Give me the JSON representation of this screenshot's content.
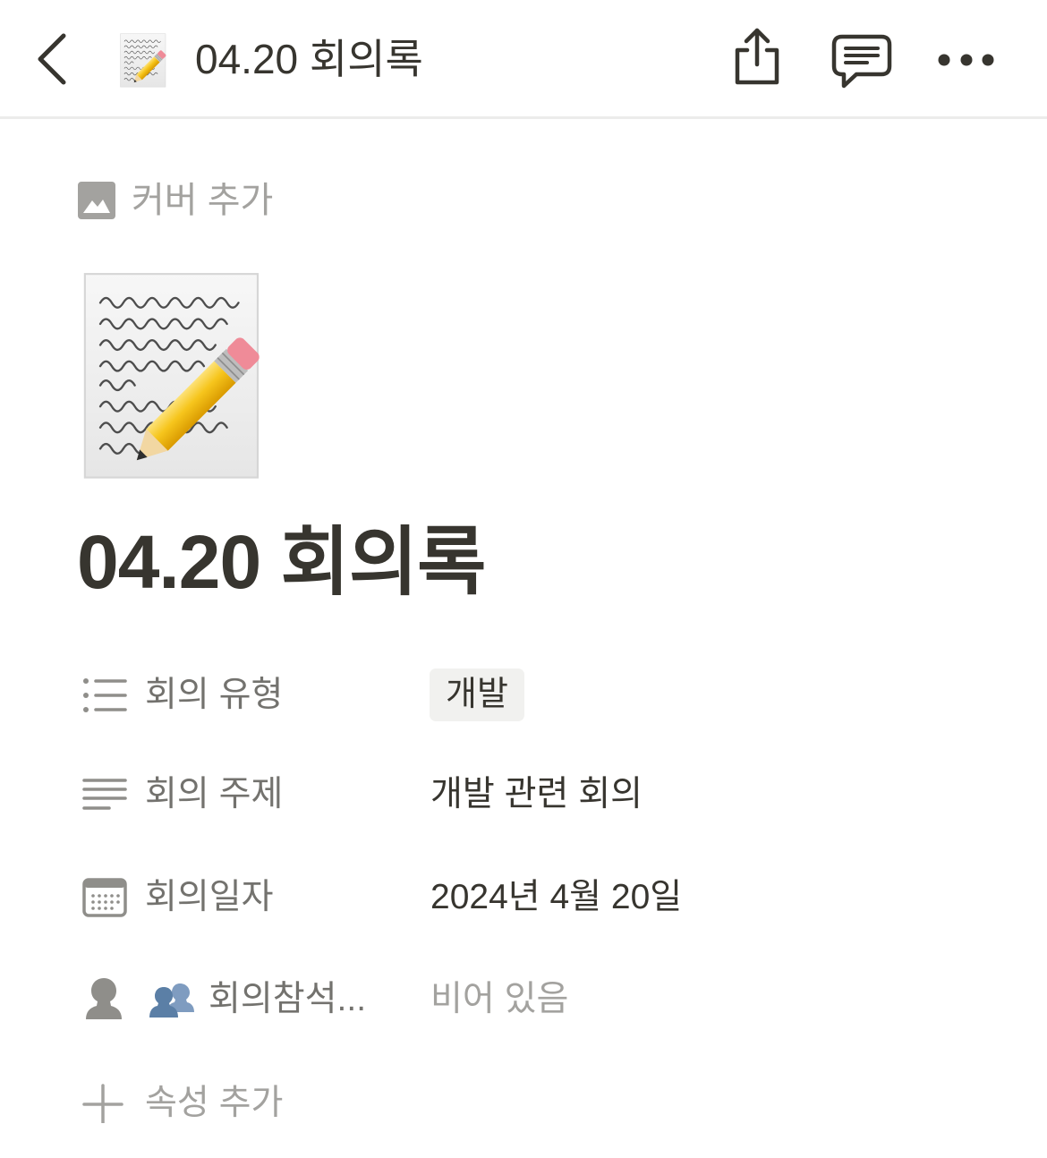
{
  "header": {
    "back_icon": "chevron-left-icon",
    "page_icon": "memo-icon",
    "title": "04.20 회의록",
    "share_icon": "share-icon",
    "comment_icon": "comment-icon",
    "more_icon": "more-horizontal-icon"
  },
  "page": {
    "add_cover": {
      "icon": "image-icon",
      "label": "커버 추가"
    },
    "icon": "memo-icon",
    "title": "04.20 회의록"
  },
  "properties": [
    {
      "icon": "list-icon",
      "name": "회의 유형",
      "type": "select",
      "value": "개발"
    },
    {
      "icon": "text-icon",
      "name": "회의 주제",
      "type": "text",
      "value": "개발 관련 회의"
    },
    {
      "icon": "calendar-icon",
      "name": "회의일자",
      "type": "date",
      "value": "2024년 4월 20일"
    },
    {
      "icon": "person-icon",
      "name_icon": "people-icon",
      "name": "회의참석...",
      "type": "person",
      "value": "비어 있음"
    }
  ],
  "add_property": {
    "icon": "plus-icon",
    "label": "속성 추가"
  },
  "colors": {
    "text": "#37352f",
    "muted": "#a3a29f",
    "property_name": "#73726e",
    "tag_background": "#f1f1ef",
    "divider": "#ececeb"
  }
}
